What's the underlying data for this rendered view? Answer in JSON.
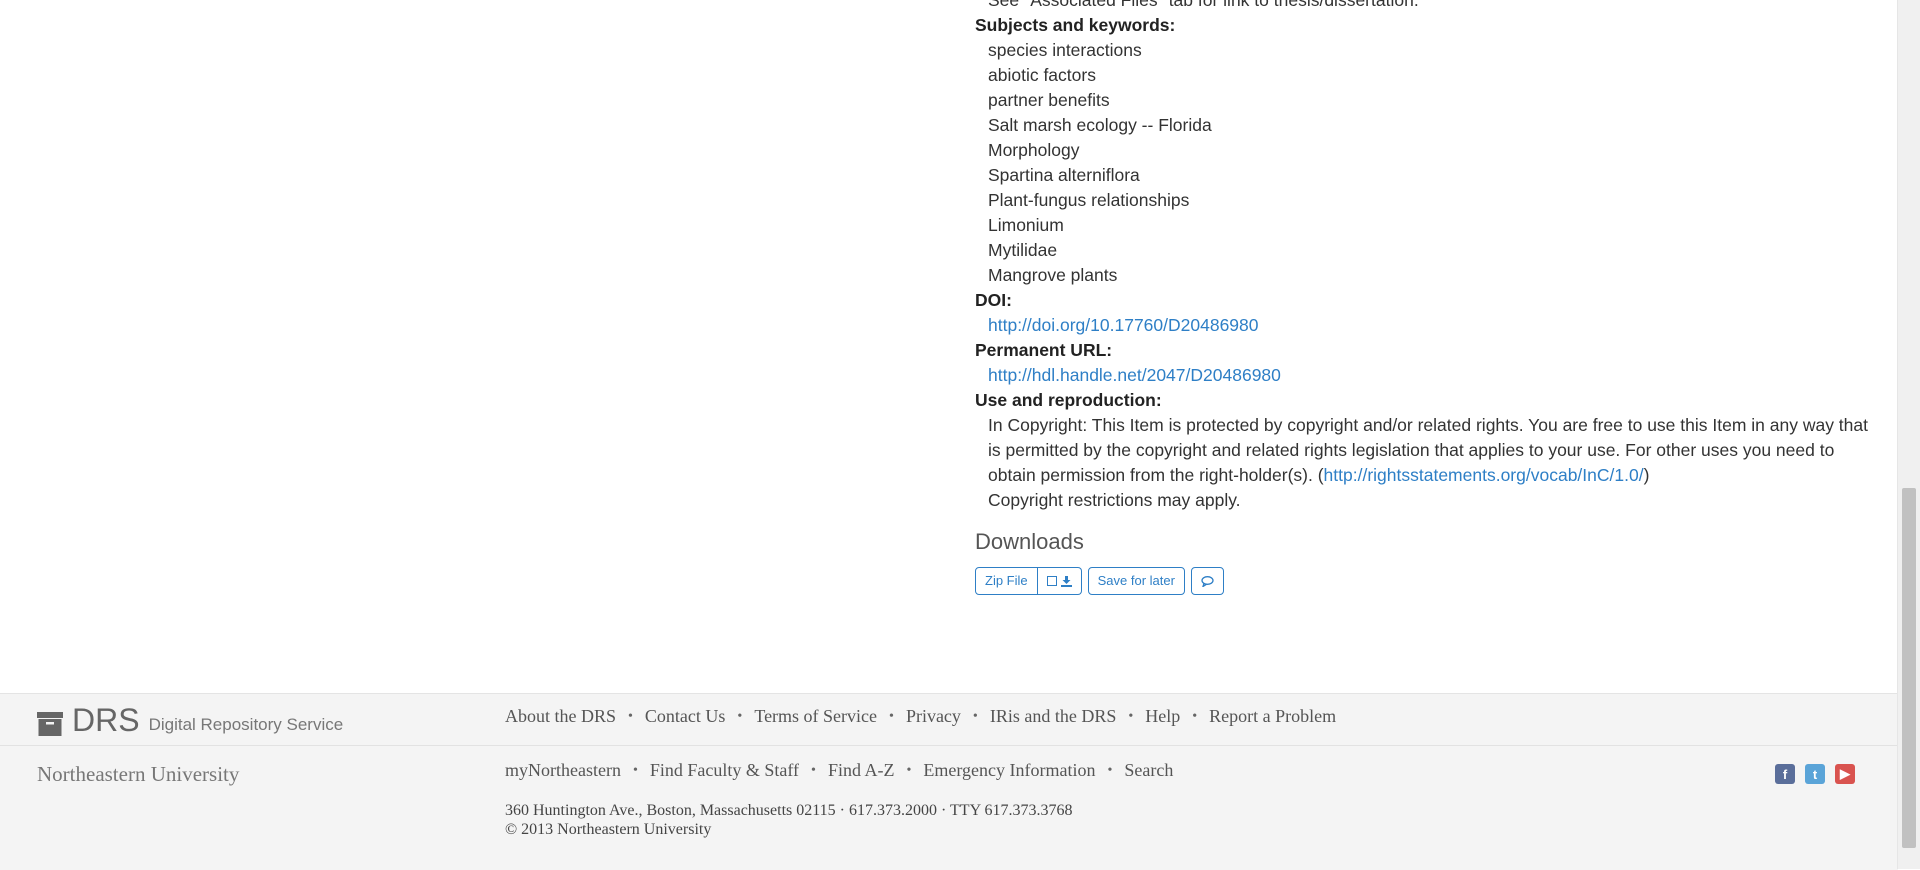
{
  "metadata": {
    "cutoff_text": "See \"Associated Files\" tab for link to thesis/dissertation.",
    "subjects_label": "Subjects and keywords:",
    "subjects": [
      "species interactions",
      "abiotic factors",
      "partner benefits",
      "Salt marsh ecology -- Florida",
      "Morphology",
      "Spartina alterniflora",
      "Plant-fungus relationships",
      "Limonium",
      "Mytilidae",
      "Mangrove plants"
    ],
    "doi_label": "DOI:",
    "doi_url": "http://doi.org/10.17760/D20486980",
    "permanent_url_label": "Permanent URL:",
    "permanent_url": "http://hdl.handle.net/2047/D20486980",
    "use_label": "Use and reproduction:",
    "use_text": "In Copyright: This Item is protected by copyright and/or related rights. You are free to use this Item in any way that is permitted by the copyright and related rights legislation that applies to your use. For other uses you need to obtain permission from the right-holder(s). (",
    "rights_url": "http://rightsstatements.org/vocab/InC/1.0/",
    "use_text_close": ")",
    "copyright_note": "Copyright restrictions may apply."
  },
  "downloads": {
    "heading": "Downloads",
    "zip_label": "Zip File",
    "save_label": "Save for later"
  },
  "footer": {
    "brand_big": "DRS",
    "brand_small": "Digital Repository Service",
    "links_row1": [
      "About the DRS",
      "Contact Us",
      "Terms of Service",
      "Privacy",
      "IRis and the DRS",
      "Help",
      "Report a Problem"
    ],
    "university": "Northeastern University",
    "links_row2": [
      "myNortheastern",
      "Find Faculty & Staff",
      "Find A-Z",
      "Emergency Information",
      "Search"
    ],
    "address": "360 Huntington Ave., Boston, Massachusetts 02115 · 617.373.2000 · TTY 617.373.3768",
    "copyright": "© 2013 Northeastern University",
    "social_icons": [
      "facebook-icon",
      "twitter-icon",
      "youtube-icon"
    ]
  },
  "colors": {
    "link": "#2e7fc6",
    "facebook": "#5a6e9a",
    "twitter": "#5aa4d8",
    "youtube": "#d9534f"
  }
}
